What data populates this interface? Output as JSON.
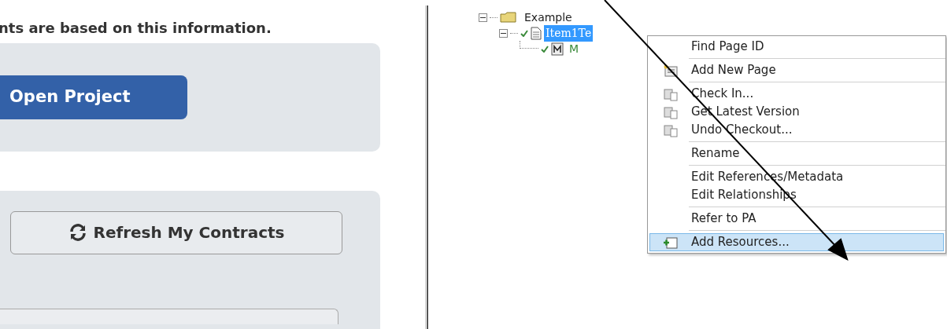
{
  "left_panel": {
    "notice": "nts are based on this information.",
    "open_button": "Open Project",
    "refresh_button": "Refresh My Contracts"
  },
  "tree": [
    {
      "label": "Example",
      "kind": "folder",
      "expanded": true,
      "checked": false,
      "selected": false,
      "children": [
        {
          "label": "Item1Te",
          "kind": "page",
          "expanded": true,
          "checked": true,
          "selected": true,
          "children": [
            {
              "label": "M",
              "kind": "module",
              "checked": true,
              "selected": false
            }
          ]
        }
      ]
    }
  ],
  "context_menu": [
    {
      "kind": "item",
      "label": "Find Page ID",
      "icon": false,
      "selected": false
    },
    {
      "kind": "separator"
    },
    {
      "kind": "item",
      "label": "Add New Page",
      "icon": true,
      "selected": false
    },
    {
      "kind": "separator"
    },
    {
      "kind": "item",
      "label": "Check In...",
      "icon": true,
      "selected": false
    },
    {
      "kind": "item",
      "label": "Get Latest Version",
      "icon": true,
      "selected": false
    },
    {
      "kind": "item",
      "label": "Undo Checkout...",
      "icon": true,
      "selected": false
    },
    {
      "kind": "separator"
    },
    {
      "kind": "item",
      "label": "Rename",
      "icon": false,
      "selected": false
    },
    {
      "kind": "separator"
    },
    {
      "kind": "item",
      "label": "Edit References/Metadata",
      "icon": false,
      "selected": false
    },
    {
      "kind": "item",
      "label": "Edit Relationships",
      "icon": false,
      "selected": false
    },
    {
      "kind": "separator"
    },
    {
      "kind": "item",
      "label": "Refer to PA",
      "icon": false,
      "selected": false
    },
    {
      "kind": "separator"
    },
    {
      "kind": "item",
      "label": "Add Resources...",
      "icon": true,
      "selected": true
    }
  ]
}
